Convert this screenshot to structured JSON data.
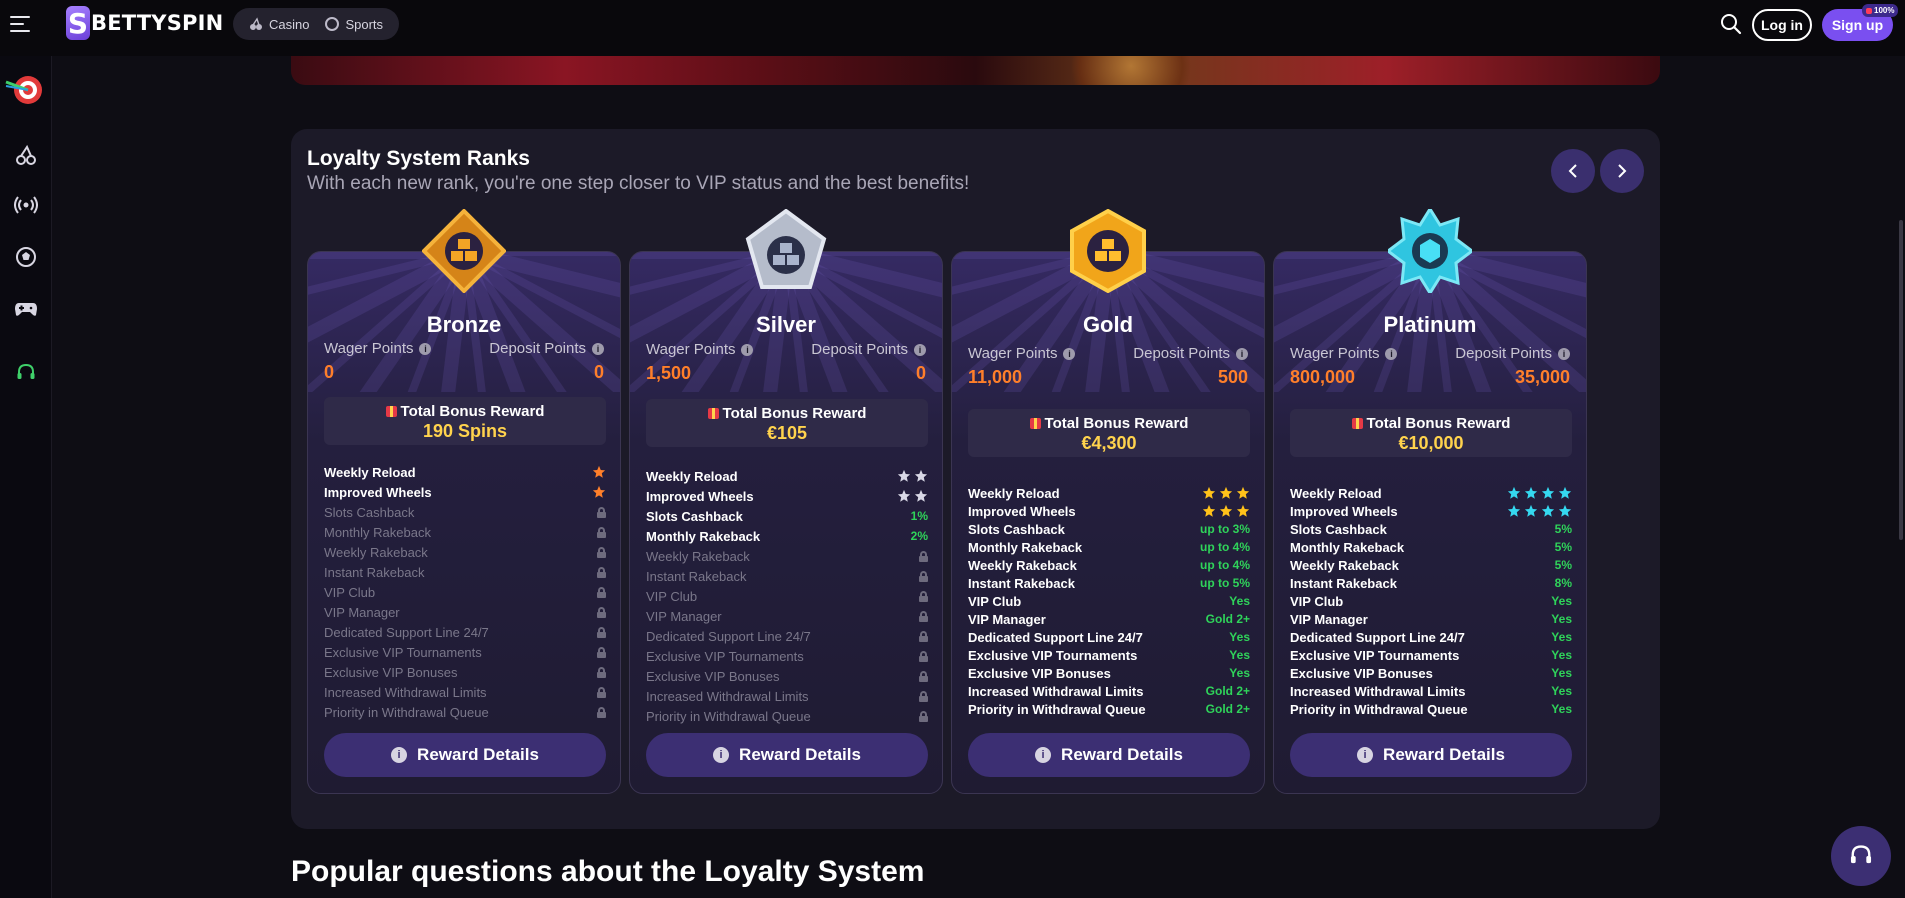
{
  "header": {
    "logo_text": "BETTYSPIN",
    "logo_letter": "S",
    "tabs": [
      {
        "label": "Casino"
      },
      {
        "label": "Sports"
      }
    ],
    "login_label": "Log in",
    "signup_label": "Sign up",
    "signup_badge": "100%"
  },
  "loyalty": {
    "title": "Loyalty System Ranks",
    "subtitle": "With each new rank, you're one step closer to VIP status and the best benefits!",
    "wager_label": "Wager Points",
    "deposit_label": "Deposit Points",
    "bonus_title": "Total Bonus Reward",
    "reward_button": "Reward Details",
    "ranks": [
      {
        "name": "Bronze",
        "wager": "0",
        "deposit": "0",
        "bonus": "190 Spins",
        "star_color": "#ff7f2a",
        "benefits": [
          {
            "label": "Weekly Reload",
            "stars": 1
          },
          {
            "label": "Improved Wheels",
            "stars": 1
          },
          {
            "label": "Slots Cashback",
            "locked": true
          },
          {
            "label": "Monthly Rakeback",
            "locked": true
          },
          {
            "label": "Weekly Rakeback",
            "locked": true
          },
          {
            "label": "Instant Rakeback",
            "locked": true
          },
          {
            "label": "VIP Club",
            "locked": true
          },
          {
            "label": "VIP Manager",
            "locked": true
          },
          {
            "label": "Dedicated Support Line 24/7",
            "locked": true
          },
          {
            "label": "Exclusive VIP Tournaments",
            "locked": true
          },
          {
            "label": "Exclusive VIP Bonuses",
            "locked": true
          },
          {
            "label": "Increased Withdrawal Limits",
            "locked": true
          },
          {
            "label": "Priority in Withdrawal Queue",
            "locked": true
          }
        ]
      },
      {
        "name": "Silver",
        "wager": "1,500",
        "deposit": "0",
        "bonus": "€105",
        "star_color": "#d9d8e6",
        "benefits": [
          {
            "label": "Weekly Reload",
            "stars": 2
          },
          {
            "label": "Improved Wheels",
            "stars": 2
          },
          {
            "label": "Slots Cashback",
            "value": "1%"
          },
          {
            "label": "Monthly Rakeback",
            "value": "2%"
          },
          {
            "label": "Weekly Rakeback",
            "locked": true
          },
          {
            "label": "Instant Rakeback",
            "locked": true
          },
          {
            "label": "VIP Club",
            "locked": true
          },
          {
            "label": "VIP Manager",
            "locked": true
          },
          {
            "label": "Dedicated Support Line 24/7",
            "locked": true
          },
          {
            "label": "Exclusive VIP Tournaments",
            "locked": true
          },
          {
            "label": "Exclusive VIP Bonuses",
            "locked": true
          },
          {
            "label": "Increased Withdrawal Limits",
            "locked": true
          },
          {
            "label": "Priority in Withdrawal Queue",
            "locked": true
          }
        ]
      },
      {
        "name": "Gold",
        "wager": "11,000",
        "deposit": "500",
        "bonus": "€4,300",
        "star_color": "#ffc21a",
        "benefits": [
          {
            "label": "Weekly Reload",
            "stars": 3
          },
          {
            "label": "Improved Wheels",
            "stars": 3
          },
          {
            "label": "Slots Cashback",
            "value": "up to 3%"
          },
          {
            "label": "Monthly Rakeback",
            "value": "up to 4%"
          },
          {
            "label": "Weekly Rakeback",
            "value": "up to 4%"
          },
          {
            "label": "Instant Rakeback",
            "value": "up to 5%"
          },
          {
            "label": "VIP Club",
            "value": "Yes"
          },
          {
            "label": "VIP Manager",
            "value": "Gold 2+"
          },
          {
            "label": "Dedicated Support Line 24/7",
            "value": "Yes"
          },
          {
            "label": "Exclusive VIP Tournaments",
            "value": "Yes"
          },
          {
            "label": "Exclusive VIP Bonuses",
            "value": "Yes"
          },
          {
            "label": "Increased Withdrawal Limits",
            "value": "Gold 2+"
          },
          {
            "label": "Priority in Withdrawal Queue",
            "value": "Gold 2+"
          }
        ]
      },
      {
        "name": "Platinum",
        "wager": "800,000",
        "deposit": "35,000",
        "bonus": "€10,000",
        "star_color": "#35d8f0",
        "benefits": [
          {
            "label": "Weekly Reload",
            "stars": 4
          },
          {
            "label": "Improved Wheels",
            "stars": 4
          },
          {
            "label": "Slots Cashback",
            "value": "5%"
          },
          {
            "label": "Monthly Rakeback",
            "value": "5%"
          },
          {
            "label": "Weekly Rakeback",
            "value": "5%"
          },
          {
            "label": "Instant Rakeback",
            "value": "8%"
          },
          {
            "label": "VIP Club",
            "value": "Yes"
          },
          {
            "label": "VIP Manager",
            "value": "Yes"
          },
          {
            "label": "Dedicated Support Line 24/7",
            "value": "Yes"
          },
          {
            "label": "Exclusive VIP Tournaments",
            "value": "Yes"
          },
          {
            "label": "Exclusive VIP Bonuses",
            "value": "Yes"
          },
          {
            "label": "Increased Withdrawal Limits",
            "value": "Yes"
          },
          {
            "label": "Priority in Withdrawal Queue",
            "value": "Yes"
          }
        ]
      }
    ]
  },
  "faq": {
    "title": "Popular questions about the Loyalty System"
  }
}
